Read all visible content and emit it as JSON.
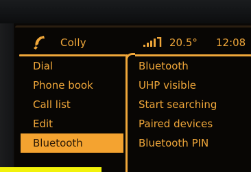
{
  "status_bar": {
    "phone_icon": "phone-handset-icon",
    "caller": "Colly",
    "signal_icon": "signal-bars-icon",
    "temperature": "20.5°",
    "clock": "12:08"
  },
  "left_menu": {
    "items": [
      {
        "label": "Dial"
      },
      {
        "label": "Phone book"
      },
      {
        "label": "Call list"
      },
      {
        "label": "Edit"
      },
      {
        "label": "Bluetooth"
      }
    ],
    "selected_label": "Bluetooth"
  },
  "right_menu": {
    "items": [
      {
        "label": "Bluetooth"
      },
      {
        "label": "UHP visible"
      },
      {
        "label": "Start searching"
      },
      {
        "label": "Paired devices"
      },
      {
        "label": "Bluetooth PIN"
      }
    ]
  },
  "colors": {
    "text": "#f0a73a",
    "selection_bg": "#f4a330",
    "selection_text": "#2a1805",
    "screen_bg": "#080604",
    "bezel": "#131416"
  }
}
